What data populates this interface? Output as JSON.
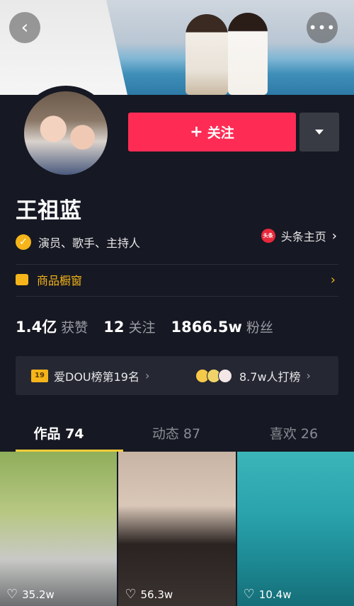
{
  "header": {
    "back_icon": "chevron-left-icon",
    "more_icon": "more-dots-icon"
  },
  "profile": {
    "name": "王祖蓝",
    "verification": "演员、歌手、主持人",
    "toutiao_icon_text": "头条",
    "toutiao_link": "头条主页",
    "follow_label": "关注",
    "shop_label": "商品橱窗"
  },
  "stats": {
    "likes_value": "1.4亿",
    "likes_label": "获赞",
    "following_value": "12",
    "following_label": "关注",
    "followers_value": "1866.5w",
    "followers_label": "粉丝"
  },
  "rank": {
    "badge": "19",
    "ranking_text": "爱DOU榜第19名",
    "supporters_text": "8.7w人打榜"
  },
  "tabs": [
    {
      "label": "作品 74"
    },
    {
      "label": "动态 87"
    },
    {
      "label": "喜欢 26"
    }
  ],
  "videos": [
    {
      "likes": "35.2w"
    },
    {
      "likes": "56.3w"
    },
    {
      "likes": "10.4w"
    }
  ],
  "colors": {
    "background": "#161823",
    "follow_button": "#fe2c55",
    "accent_yellow": "#f5b51a",
    "tab_underline": "#f5cc3b"
  }
}
